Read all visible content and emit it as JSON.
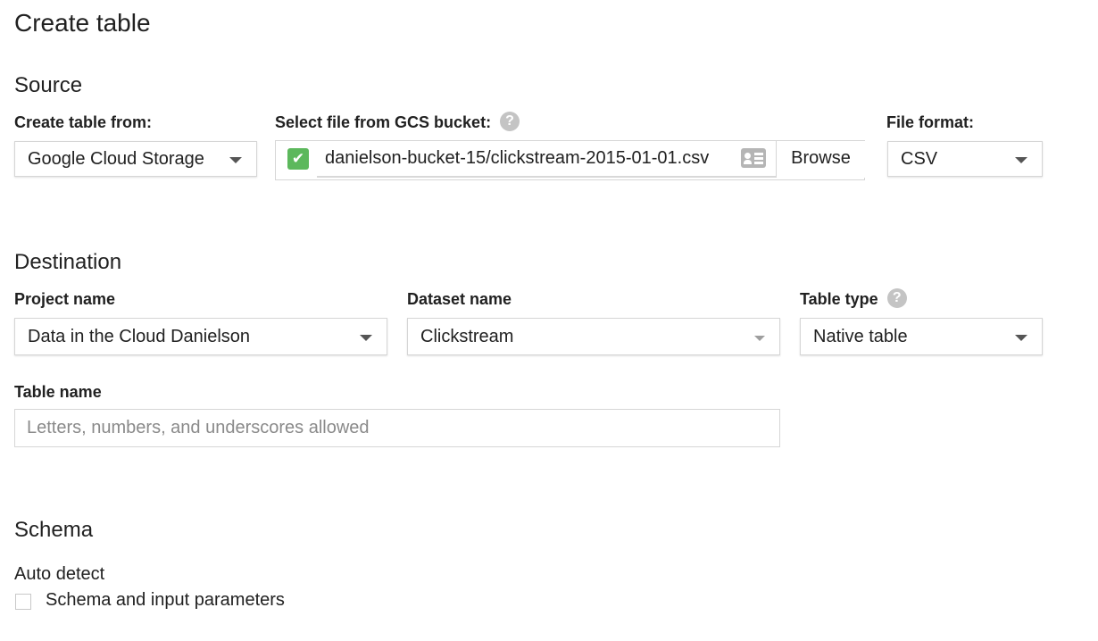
{
  "page": {
    "title": "Create table"
  },
  "source": {
    "section_title": "Source",
    "create_from_label": "Create table from:",
    "create_from_value": "Google Cloud Storage",
    "gcs_label": "Select file from GCS bucket:",
    "gcs_path": "danielson-bucket-15/clickstream-2015-01-01.csv",
    "browse_label": "Browse",
    "file_format_label": "File format:",
    "file_format_value": "CSV",
    "help_glyph": "?"
  },
  "destination": {
    "section_title": "Destination",
    "project_label": "Project name",
    "project_value": "Data in the Cloud Danielson",
    "dataset_label": "Dataset name",
    "dataset_value": "Clickstream",
    "table_type_label": "Table type",
    "table_type_value": "Native table",
    "table_name_label": "Table name",
    "table_name_value": "",
    "table_name_placeholder": "Letters, numbers, and underscores allowed"
  },
  "schema": {
    "section_title": "Schema",
    "auto_detect_label": "Auto detect",
    "auto_detect_option": "Schema and input parameters",
    "auto_detect_checked": false
  },
  "icons": {
    "help": "help-circle-icon",
    "check": "checkmark-icon",
    "file_card": "file-details-icon",
    "dropdown": "chevron-down-icon"
  },
  "colors": {
    "check_green": "#5cb85c",
    "help_gray": "#c4c4c4",
    "border": "#d6d6d6"
  }
}
